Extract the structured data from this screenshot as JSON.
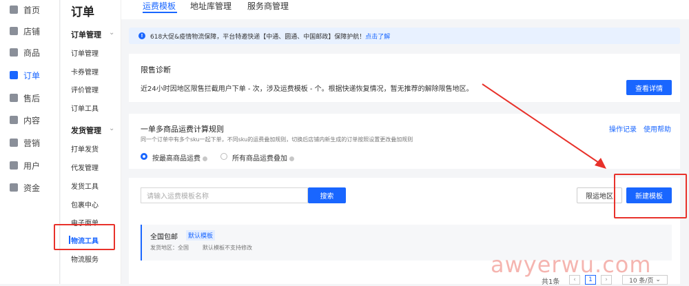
{
  "rail": {
    "items": [
      {
        "label": "首页",
        "icon": "home-icon"
      },
      {
        "label": "店铺",
        "icon": "store-icon"
      },
      {
        "label": "商品",
        "icon": "product-icon"
      },
      {
        "label": "订单",
        "icon": "order-icon"
      },
      {
        "label": "售后",
        "icon": "after-sales-icon"
      },
      {
        "label": "内容",
        "icon": "content-icon"
      },
      {
        "label": "营销",
        "icon": "marketing-icon"
      },
      {
        "label": "用户",
        "icon": "user-icon"
      },
      {
        "label": "资金",
        "icon": "funds-icon"
      }
    ]
  },
  "sub": {
    "title": "订单",
    "group1": "订单管理",
    "group1_items": [
      "订单管理",
      "卡券管理",
      "评价管理",
      "订单工具"
    ],
    "group2": "发货管理",
    "group2_items": [
      "打单发货",
      "代发管理",
      "发货工具",
      "包裹中心",
      "电子面单",
      "物流工具",
      "物流服务"
    ]
  },
  "tabs": [
    "运费模板",
    "地址库管理",
    "服务商管理"
  ],
  "notice": {
    "text": "618大促&疫情物流保障，平台特邀快递【中通、圆通、中国邮政】保障护航！",
    "link": "点击了解"
  },
  "restrict": {
    "title": "限售诊断",
    "desc": "近24小时因地区限售拦截用户下单 - 次，涉及运费模板 - 个。根据快递恢复情况，暂无推荐的解除限售地区。",
    "button": "查看详情"
  },
  "rule": {
    "title": "一单多商品运费计算规则",
    "desc": "同一个订单中有多个sku一起下单，不同sku的运费叠加规则，切换后店铺内新生成的订单按照设置更改叠加规则",
    "option1": "按最高商品运费",
    "option2": "所有商品运费叠加",
    "link1": "操作记录",
    "link2": "使用帮助"
  },
  "search": {
    "placeholder": "请输入运费模板名称",
    "button": "搜索",
    "restrict_button": "限运地区",
    "new_button": "新建模板"
  },
  "template": {
    "name": "全国包邮",
    "badge": "默认模板",
    "detail_label": "发货地区：全国",
    "note": "默认模板不支持修改"
  },
  "pager": {
    "total": "共1条",
    "current": "1",
    "page_size": "10 条/页"
  },
  "watermark": "awyerwu.com",
  "colors": {
    "accent": "#1966ff",
    "annotation": "#e8312a"
  }
}
